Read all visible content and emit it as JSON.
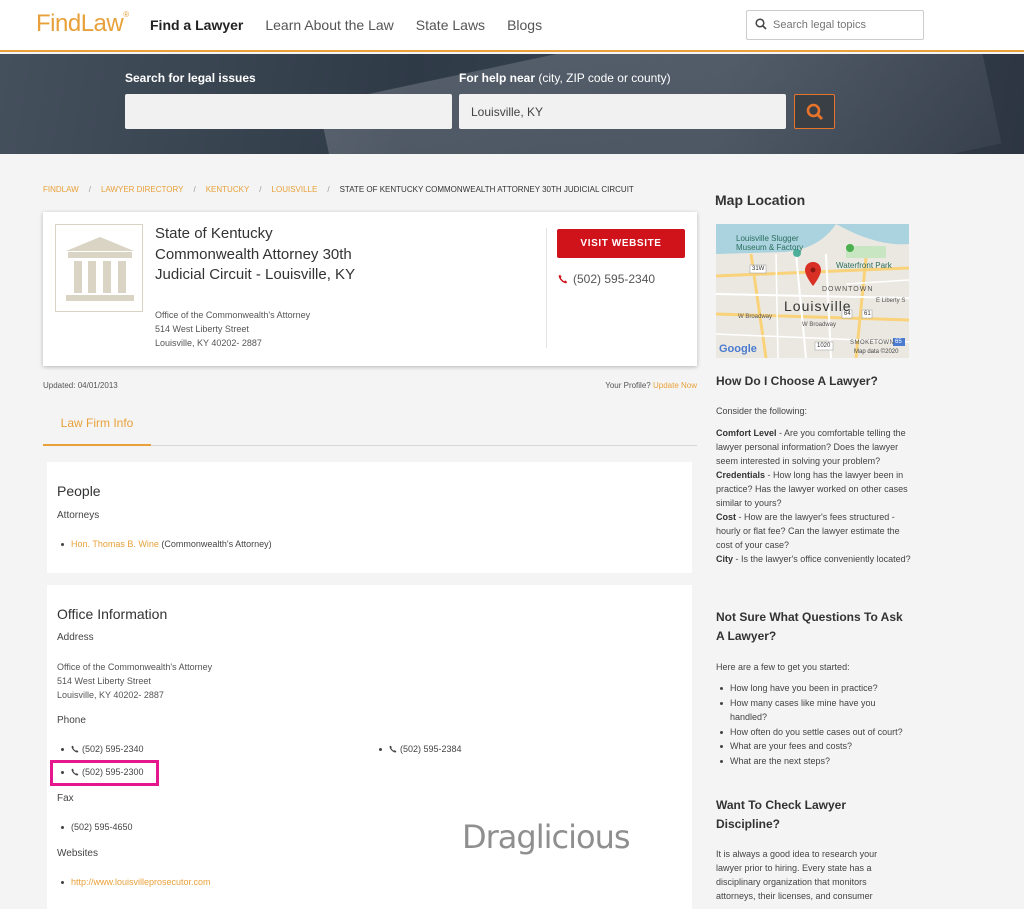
{
  "header": {
    "logo": "FindLaw",
    "logo_mark": "®",
    "nav": [
      "Find a Lawyer",
      "Learn About the Law",
      "State Laws",
      "Blogs"
    ],
    "search_placeholder": "Search legal topics"
  },
  "hero": {
    "issues_label": "Search for legal issues",
    "issues_value": "",
    "near_label": "For help near",
    "near_hint": "(city, ZIP code or county)",
    "near_value": "Louisville, KY"
  },
  "breadcrumb": [
    "FINDLAW",
    "LAWYER DIRECTORY",
    "KENTUCKY",
    "LOUISVILLE",
    "STATE OF KENTUCKY COMMONWEALTH ATTORNEY 30TH JUDICIAL CIRCUIT"
  ],
  "firm": {
    "name": "State of Kentucky Commonwealth Attorney 30th Judicial Circuit - Louisville, KY",
    "address": [
      "Office of the Commonwealth's Attorney",
      "514 West Liberty Street",
      "Louisville, KY 40202- 2887"
    ],
    "visit_label": "VISIT WEBSITE",
    "phone": "(502) 595-2340",
    "updated": "Updated: 04/01/2013",
    "profile_prompt": "Your Profile?",
    "profile_link": "Update Now"
  },
  "tabs": [
    "Law Firm Info"
  ],
  "people": {
    "title": "People",
    "subtitle": "Attorneys",
    "attorney_name": "Hon. Thomas B. Wine",
    "attorney_role": "(Commonwealth's Attorney)"
  },
  "office": {
    "title": "Office Information",
    "address_label": "Address",
    "address": [
      "Office of the Commonwealth's Attorney",
      "514 West Liberty Street",
      "Louisville, KY 40202- 2887"
    ],
    "phone_label": "Phone",
    "phones": [
      "(502) 595-2340",
      "(502) 595-2384",
      "(502) 595-2300"
    ],
    "fax_label": "Fax",
    "fax": "(502) 595-4650",
    "websites_label": "Websites",
    "website": "http://www.louisvilleprosecutor.com"
  },
  "sidebar": {
    "map_title": "Map Location",
    "map_labels": {
      "slugger": "Louisville Slugger Museum & Factory",
      "waterfront": "Waterfront Park",
      "downtown": "DOWNTOWN",
      "city": "Louisville",
      "broadway1": "W Broadway",
      "broadway2": "W Broadway",
      "liberty": "E Liberty S",
      "smoketown": "SMOKETOWN",
      "google": "Google",
      "mapdata": "Map data ©2020",
      "r31w": "31W",
      "r64": "64",
      "r61": "61",
      "r1020": "1020",
      "r65": "65"
    },
    "choose_title": "How Do I Choose A Lawyer?",
    "choose_intro": "Consider the following:",
    "criteria": [
      {
        "term": "Comfort Level",
        "text": " - Are you comfortable telling the lawyer personal information? Does the lawyer seem interested in solving your problem?"
      },
      {
        "term": "Credentials",
        "text": " - How long has the lawyer been in practice? Has the lawyer worked on other cases similar to yours?"
      },
      {
        "term": "Cost",
        "text": " - How are the lawyer's fees structured - hourly or flat fee? Can the lawyer estimate the cost of your case?"
      },
      {
        "term": "City",
        "text": " - Is the lawyer's office conveniently located?"
      }
    ],
    "questions_title": "Not Sure What Questions To Ask A Lawyer?",
    "questions_intro": "Here are a few to get you started:",
    "questions": [
      "How long have you been in practice?",
      "How many cases like mine have you handled?",
      "How often do you settle cases out of court?",
      "What are your fees and costs?",
      "What are the next steps?"
    ],
    "discipline_title": "Want To Check Lawyer Discipline?",
    "discipline_text": "It is always a good idea to research your lawyer prior to hiring. Every state has a disciplinary organization that monitors attorneys, their licenses, and consumer"
  },
  "watermark": "Draglicious",
  "colors": {
    "brand": "#e8a13a",
    "button": "#d0121b",
    "highlight": "#e6178c"
  }
}
